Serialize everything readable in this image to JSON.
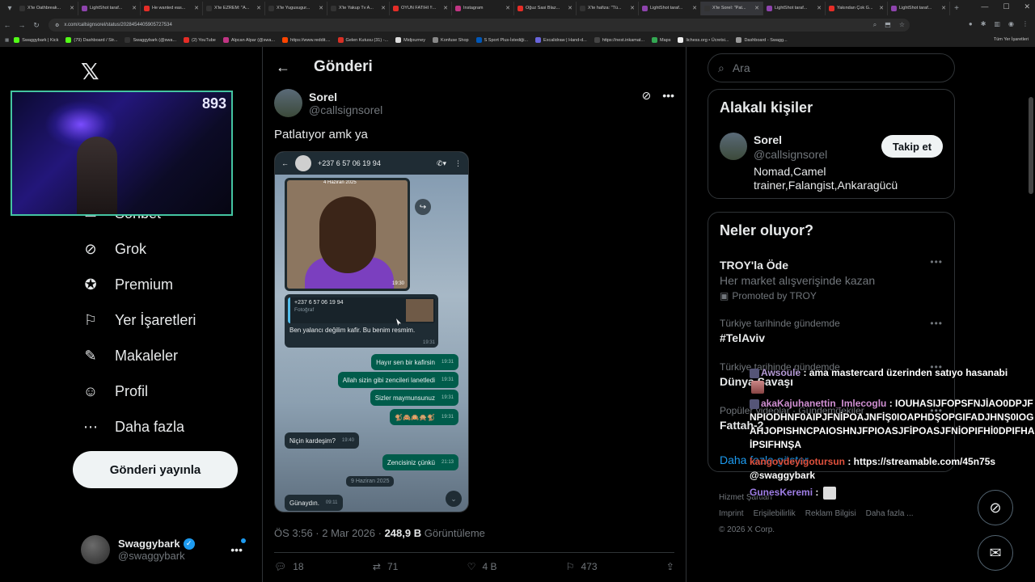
{
  "browser": {
    "tabs": [
      {
        "label": "X'te Oathbreak...",
        "color": "#333"
      },
      {
        "label": "LightShot taraf...",
        "color": "#8e44ad"
      },
      {
        "label": "He wanted eas...",
        "color": "#e52d27"
      },
      {
        "label": "X'te EZREM: \"A...",
        "color": "#333"
      },
      {
        "label": "X'te Yugusugur...",
        "color": "#333"
      },
      {
        "label": "X'te Yakup Tv A...",
        "color": "#333"
      },
      {
        "label": "OYUN FATIHI !!...",
        "color": "#e52d27"
      },
      {
        "label": "Instagram",
        "color": "#c13584"
      },
      {
        "label": "Oğuz Sasi Blaz...",
        "color": "#e52d27"
      },
      {
        "label": "X'te hafiza: \"Tü...",
        "color": "#333"
      },
      {
        "label": "LightShot taraf...",
        "color": "#8e44ad"
      },
      {
        "label": "X'te Sorel: \"Pat...",
        "color": "#333",
        "active": true
      },
      {
        "label": "LightShot taraf...",
        "color": "#8e44ad"
      },
      {
        "label": "Yakından Çok G...",
        "color": "#e52d27"
      },
      {
        "label": "LightShot taraf...",
        "color": "#8e44ad"
      }
    ],
    "url": "x.com/callsignsorel/status/2028454405905727534",
    "bookmarks": [
      {
        "label": "Swaggybark | Kick",
        "color": "#53fc18"
      },
      {
        "label": "(79) Dashboard / Str...",
        "color": "#53fc18"
      },
      {
        "label": "Swaggybark (@swa...",
        "color": "#333"
      },
      {
        "label": "(2) YouTube",
        "color": "#e52d27"
      },
      {
        "label": "Alpcan Alpar (@swa...",
        "color": "#c13584"
      },
      {
        "label": "https://www.reddit....",
        "color": "#ff4500"
      },
      {
        "label": "Gelen Kutusu (31) -...",
        "color": "#d93025"
      },
      {
        "label": "Midjourney",
        "color": "#ddd"
      },
      {
        "label": "Konfuse Shop",
        "color": "#888"
      },
      {
        "label": "S Sport Plus-İstediği...",
        "color": "#0057b8"
      },
      {
        "label": "Excalidraw | Hand-d...",
        "color": "#6965db"
      },
      {
        "label": "https://nest.inkamat...",
        "color": "#444"
      },
      {
        "label": "Maps",
        "color": "#34a853"
      },
      {
        "label": "lichess.org • Ücretsi...",
        "color": "#eee"
      },
      {
        "label": "Dashboard - Swagg...",
        "color": "#999"
      }
    ],
    "bookmarks_all": "Tüm Yer İşaretleri"
  },
  "webcam": {
    "counter": "893"
  },
  "nav": {
    "items": [
      {
        "label": "Sohbet",
        "icon": "chat-icon"
      },
      {
        "label": "Grok",
        "icon": "grok-icon"
      },
      {
        "label": "Premium",
        "icon": "premium-icon"
      },
      {
        "label": "Yer İşaretleri",
        "icon": "bookmark-icon"
      },
      {
        "label": "Makaleler",
        "icon": "articles-icon"
      },
      {
        "label": "Profil",
        "icon": "profile-icon"
      },
      {
        "label": "Daha fazla",
        "icon": "more-icon"
      }
    ],
    "post_button": "Gönderi yayınla",
    "account": {
      "name": "Swaggybark",
      "handle": "@swaggybark"
    }
  },
  "main": {
    "title": "Gönderi",
    "author": {
      "name": "Sorel",
      "handle": "@callsignsorel"
    },
    "text": "Patlatıyor amk ya",
    "whatsapp": {
      "contact": "+237 6 57 06 19 94",
      "date_top": "4 Haziran 2025",
      "photo_time": "19:30",
      "reply_quote_name": "+237 6 57 06 19 94",
      "reply_quote_type": "Fotoğraf",
      "reply_body": "Ben yalancı değilim kafir. Bu benim resmim.",
      "reply_time": "19:31",
      "green_messages": [
        {
          "text": "Hayır sen bir kafirsin",
          "time": "19:31"
        },
        {
          "text": "Allah sizin gibi zencileri lanetledi",
          "time": "19:31"
        },
        {
          "text": "Sizler maymunsunuz",
          "time": "19:31"
        },
        {
          "text": "🐒🙈🙉🙊🐒",
          "time": "19:31"
        }
      ],
      "white_message_1": {
        "text": "Niçin kardeşim?",
        "time": "19:40"
      },
      "green_message_2": {
        "text": "Zencisiniz çünkü",
        "time": "21:13"
      },
      "date_chip": "9 Haziran 2025",
      "white_message_2": {
        "text": "Günaydın.",
        "time": "09:11"
      }
    },
    "meta": {
      "time": "ÖS 3:56 · 2 Mar 2026 · ",
      "views": "248,9 B",
      "views_label": " Görüntüleme"
    },
    "actions": {
      "replies": "18",
      "reposts": "71",
      "likes": "4 B",
      "bookmarks": "473"
    }
  },
  "right": {
    "search_placeholder": "Ara",
    "related_title": "Alakalı kişiler",
    "related": {
      "name": "Sorel",
      "handle": "@callsignsorel",
      "bio": "Nomad,Camel trainer,Falangist,Ankaragücü",
      "follow": "Takip et"
    },
    "trends_title": "Neler oluyor?",
    "trends": [
      {
        "ctx": "",
        "title": "TROY'la Öde",
        "sub": "Her market alışverişinde kazan",
        "promo": "Promoted by TROY"
      },
      {
        "ctx": "Türkiye tarihinde gündemde",
        "title": "#TelAviv"
      },
      {
        "ctx": "Türkiye tarihinde gündemde",
        "title": "Dünya Savaşı"
      },
      {
        "ctx": "Popüler videolar · Gündemdekiler",
        "title": "Fattah-2"
      }
    ],
    "show_more": "Daha fazla göster",
    "footer": [
      "Hizmet Şartları",
      "Imprint",
      "Erişilebilirlik",
      "Reklam Bilgisi",
      "Daha fazla ...",
      "© 2026 X Corp."
    ]
  },
  "chat": [
    {
      "user": "Awsoule",
      "msg": " : ama mastercard üzerinden satıyo hasanabi"
    },
    {
      "user": "akaKajuhanettin_Imlecoglu",
      "msg": " : IOUHASIJFOPSFNJİAO0DPJFNPIODHNF0AIPJFNİPOAJNFİŞ0IOAPHDŞOPGIFADJHNŞ0IOGAHJOPISHNCPAIOSHNJFPIOASJFİPOASJFNİOPIFHİ0DPIFHAİPSIFHNŞA"
    },
    {
      "user": "kangovdeyigotursun",
      "msg": " : https://streamable.com/45n75s @swaggybark"
    },
    {
      "user": "GunesKeremi",
      "msg": " : "
    }
  ]
}
